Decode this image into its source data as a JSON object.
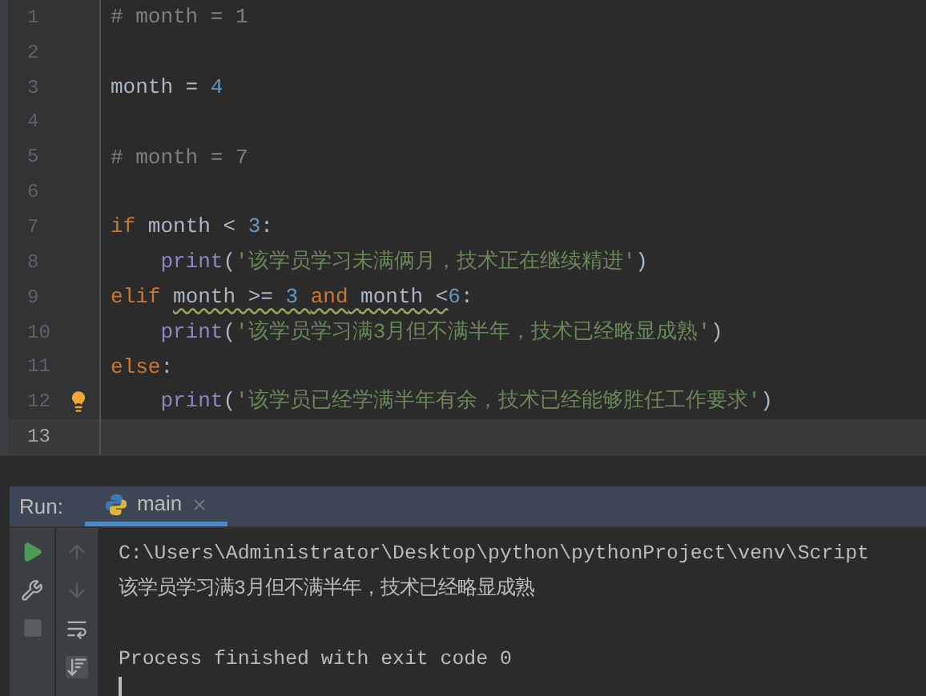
{
  "editor": {
    "lines": [
      {
        "number": "1",
        "current": false,
        "bulb": false,
        "tokens": [
          {
            "kind": "comment",
            "text": "# month = 1",
            "warn": false
          }
        ]
      },
      {
        "number": "2",
        "current": false,
        "bulb": false
      },
      {
        "number": "3",
        "current": false,
        "bulb": false,
        "tokens": [
          {
            "kind": "ident",
            "text": "month = ",
            "warn": false
          },
          {
            "kind": "number",
            "text": "4",
            "warn": false
          }
        ]
      },
      {
        "number": "4",
        "current": false,
        "bulb": false
      },
      {
        "number": "5",
        "current": false,
        "bulb": false,
        "tokens": [
          {
            "kind": "comment",
            "text": "# month = 7",
            "warn": false
          }
        ]
      },
      {
        "number": "6",
        "current": false,
        "bulb": false
      },
      {
        "number": "7",
        "current": false,
        "bulb": false,
        "tokens": [
          {
            "kind": "keyword",
            "text": "if",
            "warn": false
          },
          {
            "kind": "ident",
            "text": " month < ",
            "warn": false
          },
          {
            "kind": "number",
            "text": "3",
            "warn": false
          },
          {
            "kind": "ident",
            "text": ":",
            "warn": false
          }
        ]
      },
      {
        "number": "8",
        "current": false,
        "bulb": false,
        "tokens": [
          {
            "kind": "func",
            "text": "    print",
            "warn": false
          },
          {
            "kind": "ident",
            "text": "(",
            "warn": false
          },
          {
            "kind": "string",
            "text": "'该学员学习未满俩月，技术正在继续精进'",
            "warn": false
          },
          {
            "kind": "ident",
            "text": ")",
            "warn": false
          }
        ]
      },
      {
        "number": "9",
        "current": false,
        "bulb": false,
        "tokens": [
          {
            "kind": "keyword",
            "text": "elif ",
            "warn": false
          },
          {
            "kind": "ident",
            "text": "month >= ",
            "warn": true
          },
          {
            "kind": "number",
            "text": "3 ",
            "warn": true
          },
          {
            "kind": "keyword",
            "text": "and",
            "warn": true
          },
          {
            "kind": "ident",
            "text": " month <",
            "warn": true
          },
          {
            "kind": "number",
            "text": "6",
            "warn": false
          },
          {
            "kind": "ident",
            "text": ":",
            "warn": false
          }
        ]
      },
      {
        "number": "10",
        "current": false,
        "bulb": false,
        "tokens": [
          {
            "kind": "func",
            "text": "    print",
            "warn": false
          },
          {
            "kind": "ident",
            "text": "(",
            "warn": false
          },
          {
            "kind": "string",
            "text": "'该学员学习满3月但不满半年，技术已经略显成熟'",
            "warn": false
          },
          {
            "kind": "ident",
            "text": ")",
            "warn": false
          }
        ]
      },
      {
        "number": "11",
        "current": false,
        "bulb": false,
        "tokens": [
          {
            "kind": "keyword",
            "text": "else",
            "warn": false
          },
          {
            "kind": "ident",
            "text": ":",
            "warn": false
          }
        ]
      },
      {
        "number": "12",
        "current": false,
        "bulb": true,
        "tokens": [
          {
            "kind": "func",
            "text": "    print",
            "warn": false
          },
          {
            "kind": "ident",
            "text": "(",
            "warn": false
          },
          {
            "kind": "string",
            "text": "'该学员已经学满半年有余，技术已经能够胜任工作要求'",
            "warn": false
          },
          {
            "kind": "ident",
            "text": ")",
            "warn": false
          }
        ]
      },
      {
        "number": "13",
        "current": true,
        "bulb": false
      }
    ]
  },
  "run_panel": {
    "label": "Run:",
    "tabs": [
      {
        "label": "main",
        "selected": true
      }
    ],
    "console": {
      "output": [
        "C:\\Users\\Administrator\\Desktop\\python\\pythonProject\\venv\\Script",
        "该学员学习满3月但不满半年，技术已经略显成熟"
      ],
      "exit_message": "Process finished with exit code 0"
    }
  }
}
